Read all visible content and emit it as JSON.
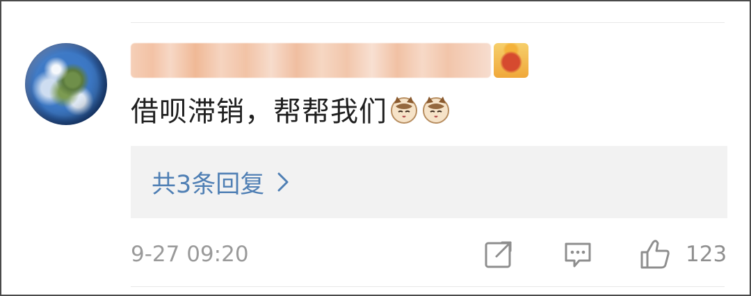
{
  "comment": {
    "text": "借呗滞销，帮帮我们",
    "emoji": "cat-face-emoji",
    "replies_label": "共3条回复",
    "timestamp": "9-27 09:20",
    "like_count": "123"
  },
  "icons": {
    "share": "share-icon",
    "comment": "comment-icon",
    "like": "thumbs-up-icon",
    "chevron": "chevron-right-icon"
  },
  "colors": {
    "link": "#4f7fb4",
    "muted": "#9a9a9a",
    "reply_bg": "#f2f2f2",
    "text": "#1f1f1f"
  }
}
